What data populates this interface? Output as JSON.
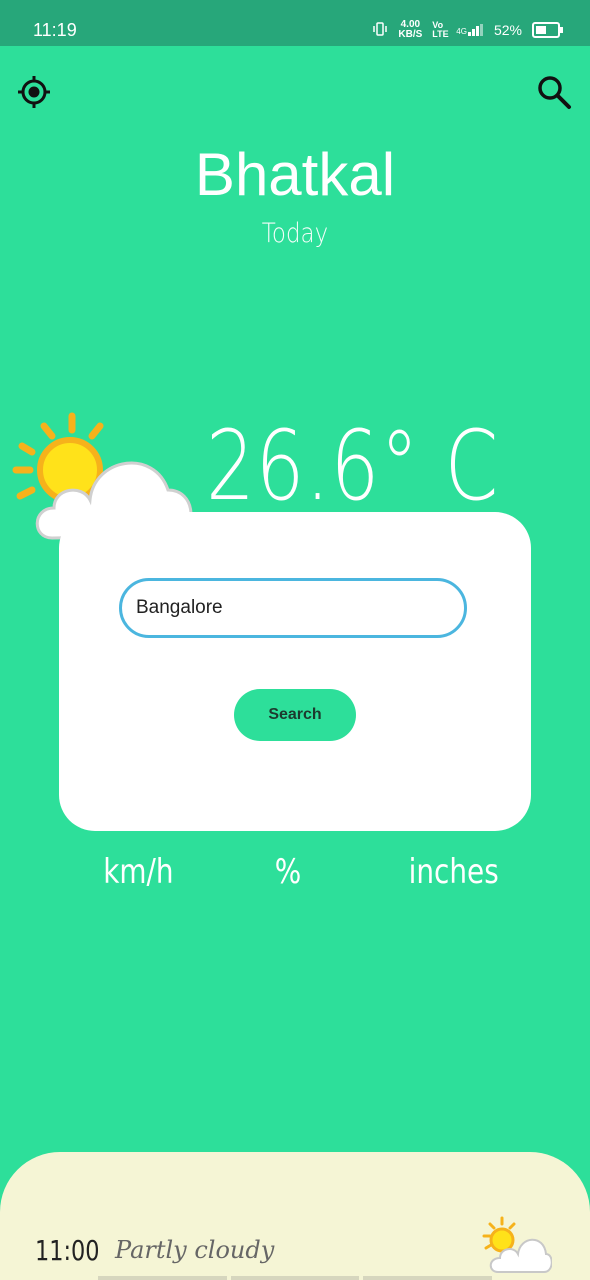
{
  "status_bar": {
    "time": "11:19",
    "net_speed_top": "4.00",
    "net_speed_bottom": "KB/S",
    "volte": "Vo LTE",
    "signal": "4G",
    "battery": "52%"
  },
  "header": {
    "location_icon": "crosshair-location-icon",
    "search_icon": "search-icon"
  },
  "weather": {
    "city": "Bhatkal",
    "day": "Today",
    "temperature": "26.6° C",
    "condition_icon": "partly-cloudy-icon"
  },
  "metrics": {
    "wind_unit": "km/h",
    "humidity_unit": "%",
    "rain_unit": "inches"
  },
  "search_dialog": {
    "input_value": "Bangalore",
    "button_label": "Search"
  },
  "hourly": {
    "items": [
      {
        "time": "11:00",
        "description": "Partly cloudy",
        "icon": "partly-cloudy-icon"
      }
    ]
  },
  "colors": {
    "background": "#2ddf9a",
    "status_bar": "#27a77a",
    "input_border": "#4bb6df",
    "bottom_panel": "#f5f5d5"
  }
}
